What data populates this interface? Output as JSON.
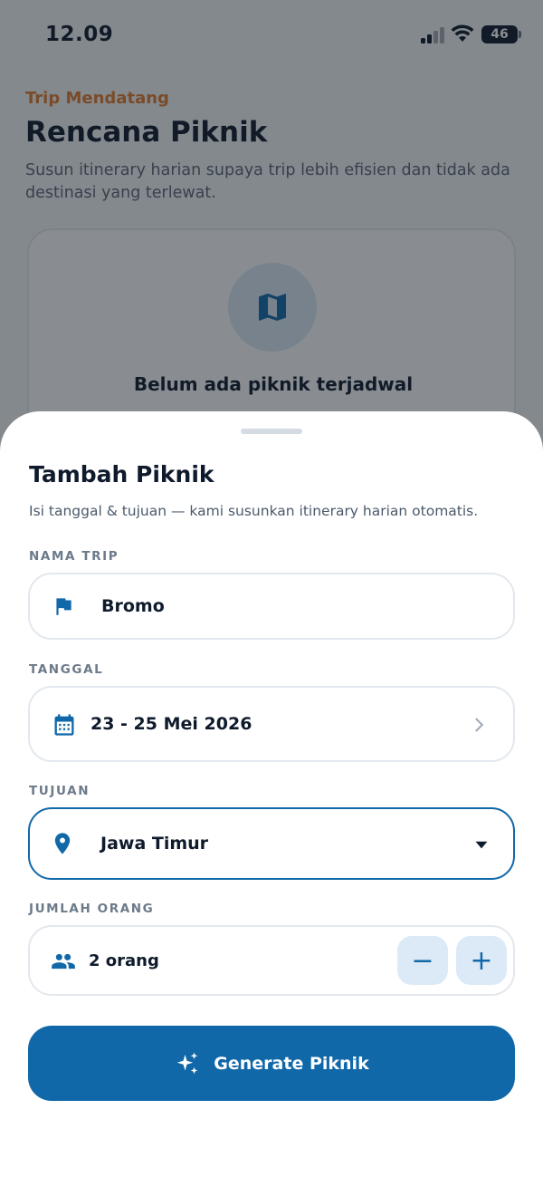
{
  "status_bar": {
    "time": "12.09",
    "battery": "46"
  },
  "background": {
    "eyebrow": "Trip Mendatang",
    "title": "Rencana Piknik",
    "subtitle": "Susun itinerary harian supaya trip lebih efisien dan tidak ada destinasi yang terlewat.",
    "empty_state": {
      "title": "Belum ada piknik terjadwal"
    }
  },
  "sheet": {
    "title": "Tambah Piknik",
    "subtitle": "Isi tanggal & tujuan — kami susunkan itinerary harian otomatis.",
    "trip_name": {
      "label": "NAMA TRIP",
      "value": "Bromo"
    },
    "date": {
      "label": "TANGGAL",
      "value": "23 - 25 Mei 2026"
    },
    "destination": {
      "label": "TUJUAN",
      "value": "Jawa Timur"
    },
    "people": {
      "label": "JUMLAH ORANG",
      "value": "2 orang",
      "decrement": "−",
      "increment": "+"
    },
    "generate_label": "Generate Piknik"
  },
  "colors": {
    "accent": "#1168a8",
    "eyebrow": "#e07a2f",
    "text": "#0f1b2d"
  }
}
